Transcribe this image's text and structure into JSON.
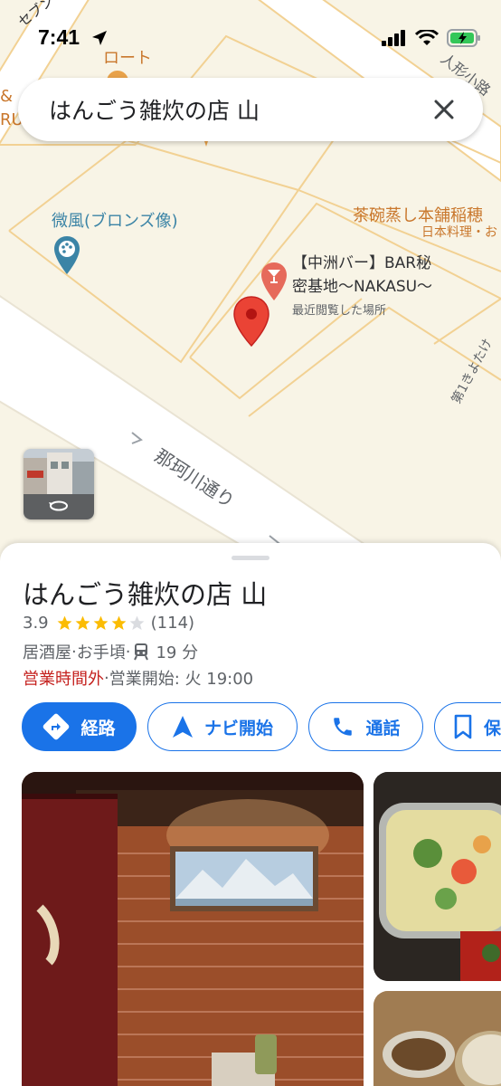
{
  "status_bar": {
    "time": "7:41"
  },
  "search": {
    "query": "はんごう雑炊の店 山",
    "clear_icon": "close-icon"
  },
  "map": {
    "labels": {
      "seven": "セブンイレブ",
      "roto": "ロート",
      "edge_and": "& ",
      "edge_ru": "RU",
      "ningyo": "人形小路",
      "sculpture": "微風(ブロンズ像)",
      "chawanmushi": "茶碗蒸し本舗稲穂",
      "japanese_food": "日本料理・お",
      "bar_line1": "【中洲バー】BAR秘",
      "bar_line2": "密基地〜NAKASU〜",
      "recently_viewed": "最近閲覧した場所",
      "road": "那珂川通り",
      "side_street": "第1きよたけ"
    },
    "colors": {
      "land": "#f8f4e6",
      "road_fill": "#ffffff",
      "road_edge": "#f2d193",
      "pin": "#ea4335",
      "poi_blue": "#3b84a6"
    }
  },
  "place": {
    "name": "はんごう雑炊の店 山",
    "rating": "3.9",
    "rating_value": 3.9,
    "stars_filled": 4,
    "review_count": "(114)",
    "category": "居酒屋",
    "price": "お手頃",
    "transit_time": "19 分",
    "hours_status": "営業時間外",
    "hours_detail": "営業開始: 火 19:00",
    "separator": " · "
  },
  "actions": {
    "directions": "経路",
    "navigate": "ナビ開始",
    "call": "通話",
    "save": "保"
  },
  "colors": {
    "accent": "#1a73e8",
    "closed": "#c5221f",
    "star": "#fbbc04"
  }
}
